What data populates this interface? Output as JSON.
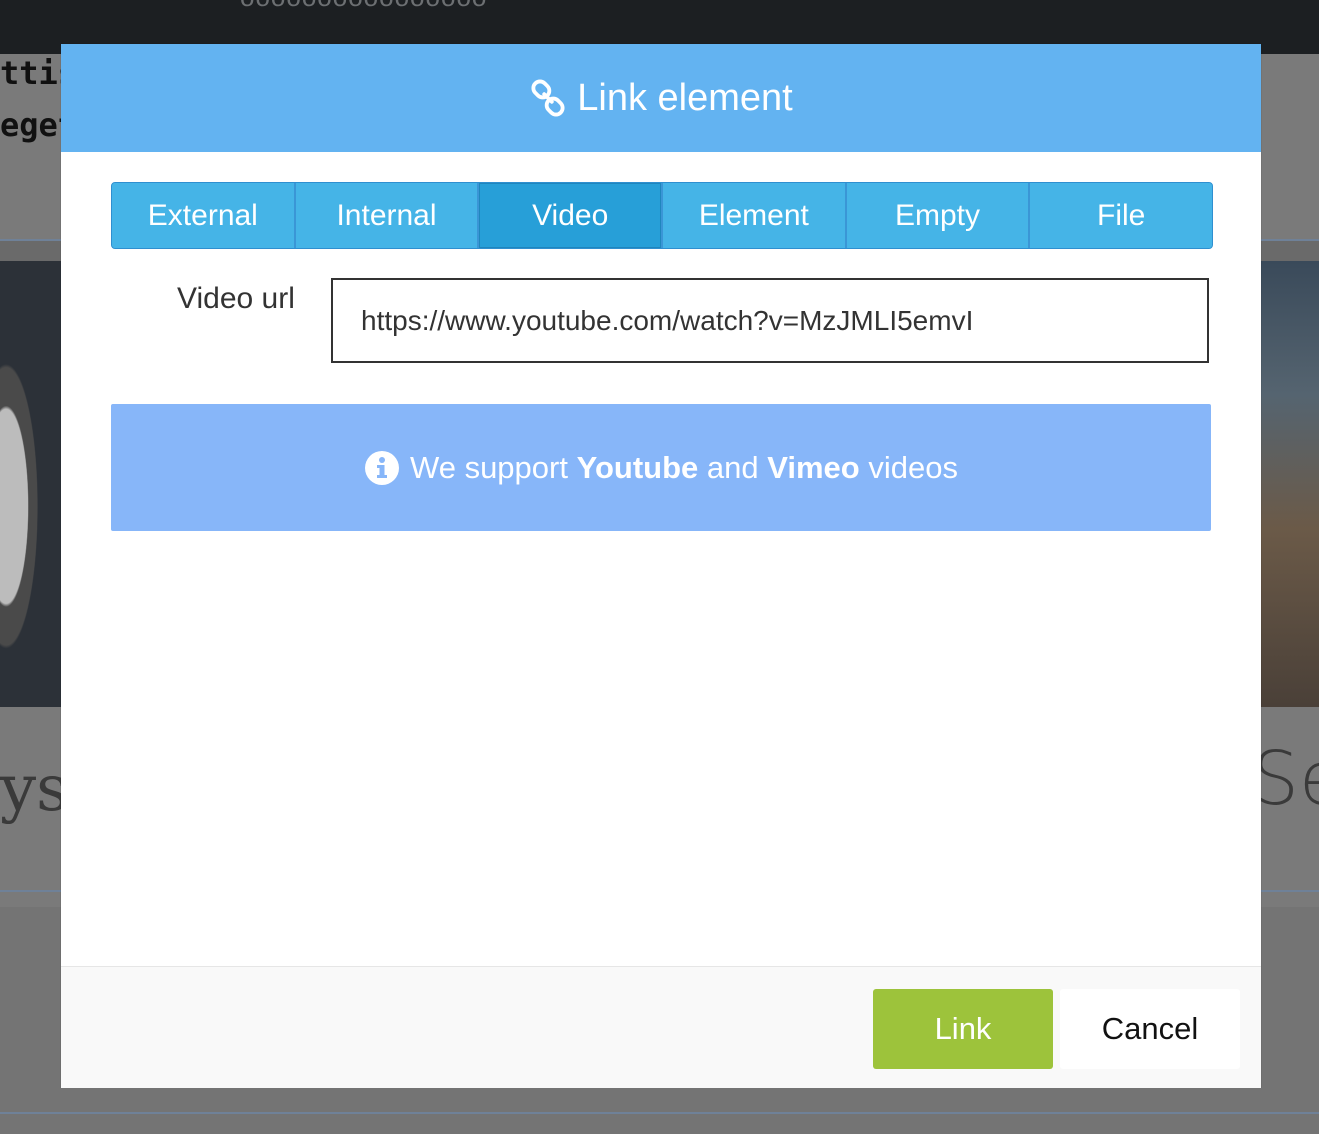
{
  "background": {
    "topbar_text": "oooooooooooooooo",
    "text_line_1": "ttis.",
    "text_line_2": "eget",
    "big_text_left": "ys",
    "big_text_right": "Se"
  },
  "modal": {
    "title": "Link element",
    "title_icon": "chain-link-icon",
    "tabs": [
      {
        "label": "External",
        "active": false
      },
      {
        "label": "Internal",
        "active": false
      },
      {
        "label": "Video",
        "active": true
      },
      {
        "label": "Element",
        "active": false
      },
      {
        "label": "Empty",
        "active": false
      },
      {
        "label": "File",
        "active": false
      }
    ],
    "video_url_label": "Video url",
    "video_url_value": "https://www.youtube.com/watch?v=MzJMLI5emvI",
    "info": {
      "icon": "info-circle-icon",
      "prefix": "We support",
      "brand1": "Youtube",
      "conjunction": "and",
      "brand2": "Vimeo",
      "suffix": "videos"
    },
    "footer": {
      "primary_label": "Link",
      "secondary_label": "Cancel"
    }
  },
  "colors": {
    "header": "#63b3f1",
    "tab": "#45b4e7",
    "tab_active": "#279fd8",
    "info_box": "#87b6f9",
    "primary_button": "#9dc33b"
  }
}
